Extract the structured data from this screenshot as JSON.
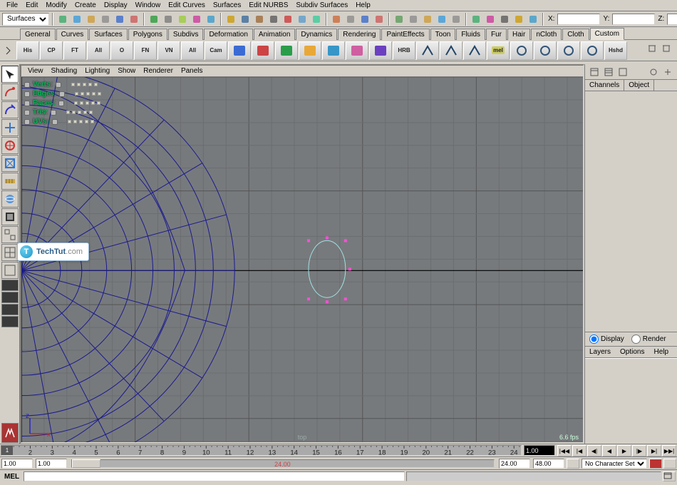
{
  "menubar": [
    "File",
    "Edit",
    "Modify",
    "Create",
    "Display",
    "Window",
    "Edit Curves",
    "Surfaces",
    "Edit NURBS",
    "Subdiv Surfaces",
    "Help"
  ],
  "module_dropdown": "Surfaces",
  "coords": {
    "x_label": "X:",
    "y_label": "Y:",
    "z_label": "Z:",
    "x": "",
    "y": "",
    "z": ""
  },
  "shelf_tabs": [
    "General",
    "Curves",
    "Surfaces",
    "Polygons",
    "Subdivs",
    "Deformation",
    "Animation",
    "Dynamics",
    "Rendering",
    "PaintEffects",
    "Toon",
    "Fluids",
    "Fur",
    "Hair",
    "nCloth",
    "Cloth",
    "Custom"
  ],
  "active_shelf": "Custom",
  "shelf_buttons": [
    "His",
    "CP",
    "FT",
    "All",
    "O",
    "FN",
    "VN",
    "All",
    "Cam"
  ],
  "shelf_suffix": [
    "HRB",
    "Hshd"
  ],
  "mel_badge": "mel",
  "view_menu": [
    "View",
    "Shading",
    "Lighting",
    "Show",
    "Renderer",
    "Panels"
  ],
  "component_menu": [
    "Verts:",
    "Edges:",
    "Faces:",
    "Tris:",
    "UVs:"
  ],
  "view_name": "top",
  "fps": "6.6 fps",
  "axis_labels": {
    "x": "x",
    "z": "z"
  },
  "channel_tabs": [
    "Channels",
    "Object"
  ],
  "layer_radios": {
    "display": "Display",
    "render": "Render"
  },
  "layer_menu": [
    "Layers",
    "Options",
    "Help"
  ],
  "timeline": {
    "ticks": [
      "1",
      "2",
      "3",
      "4",
      "5",
      "6",
      "7",
      "8",
      "9",
      "10",
      "11",
      "12",
      "13",
      "14",
      "15",
      "16",
      "17",
      "18",
      "19",
      "20",
      "21",
      "22",
      "23",
      "24"
    ],
    "current": "1",
    "current_field": "1.00",
    "range_start_outer": "1.00",
    "range_start_inner": "1.00",
    "range_end_inner": "24.00",
    "range_end_outer": "48.00",
    "range_mid_label": "24.00",
    "charset": "No Character Set"
  },
  "cmd": {
    "label": "MEL"
  },
  "watermark": {
    "logo": "T",
    "t1": "TechTut",
    "t2": ".com"
  }
}
